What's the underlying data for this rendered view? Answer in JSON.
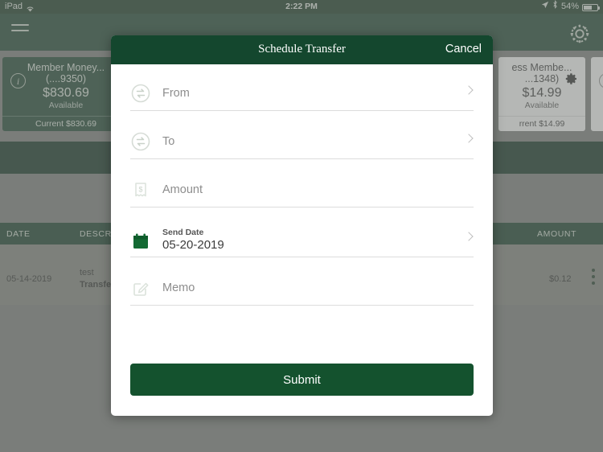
{
  "status_bar": {
    "device": "iPad",
    "wifi_icon": "wifi-icon",
    "time": "2:22 PM",
    "location_icon": "location-arrow-icon",
    "bluetooth_icon": "bluetooth-icon",
    "battery_percent": "54%",
    "battery_icon": "battery-icon"
  },
  "nav_bar": {
    "menu_icon": "hamburger-menu-icon",
    "settings_icon": "gear-icon"
  },
  "accounts": [
    {
      "name": "Member Money...",
      "number": "(....9350)",
      "balance": "$830.69",
      "sub": "Available",
      "footer": "Current $830.69",
      "icon": "info-icon"
    },
    {
      "name": "ess Membe...",
      "number": "...1348)",
      "balance": "$14.99",
      "sub": "Available",
      "footer": "rrent $14.99",
      "icon": "gear-icon"
    }
  ],
  "transactions_table": {
    "columns": [
      "DATE",
      "DESCRIPTION",
      "AMOUNT"
    ],
    "rows": [
      {
        "date": "05-14-2019",
        "description_line1": "test",
        "description_line2": "Transfer",
        "amount": "$0.12",
        "menu_icon": "more-vertical-icon"
      }
    ]
  },
  "modal": {
    "title": "Schedule Transfer",
    "cancel_label": "Cancel",
    "submit_label": "Submit",
    "fields": [
      {
        "label": "From",
        "icon": "transfer-circle-icon",
        "value": "",
        "chevron": true
      },
      {
        "label": "To",
        "icon": "transfer-circle-icon",
        "value": "",
        "chevron": true
      },
      {
        "label": "Amount",
        "icon": "dollar-receipt-icon",
        "value": "",
        "chevron": false
      },
      {
        "label": "Send Date",
        "icon": "calendar-icon",
        "value": "05-20-2019",
        "chevron": true
      },
      {
        "label": "Memo",
        "icon": "edit-note-icon",
        "value": "",
        "chevron": false
      }
    ]
  },
  "colors": {
    "brand_green": "#14472e",
    "nav_green": "#1c4430",
    "dark_green": "#0d2e1d",
    "submit_green": "#14522e",
    "scrim_gray": "#7c7f7c"
  }
}
